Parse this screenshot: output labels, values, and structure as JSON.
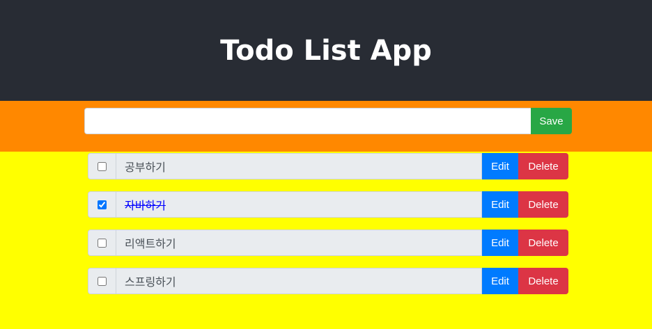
{
  "header": {
    "title": "Todo List App"
  },
  "colors": {
    "header_bg": "#282c34",
    "input_band_bg": "#ff8800",
    "list_bg": "#ffff00",
    "save": "#28a745",
    "edit": "#007bff",
    "delete": "#dc3545",
    "done_text": "#0000ff"
  },
  "input": {
    "value": "",
    "placeholder": "",
    "save_label": "Save"
  },
  "todos": [
    {
      "text": "공부하기",
      "done": false,
      "edit_label": "Edit",
      "delete_label": "Delete"
    },
    {
      "text": "자바하기",
      "done": true,
      "edit_label": "Edit",
      "delete_label": "Delete"
    },
    {
      "text": "리액트하기",
      "done": false,
      "edit_label": "Edit",
      "delete_label": "Delete"
    },
    {
      "text": "스프링하기",
      "done": false,
      "edit_label": "Edit",
      "delete_label": "Delete"
    }
  ]
}
